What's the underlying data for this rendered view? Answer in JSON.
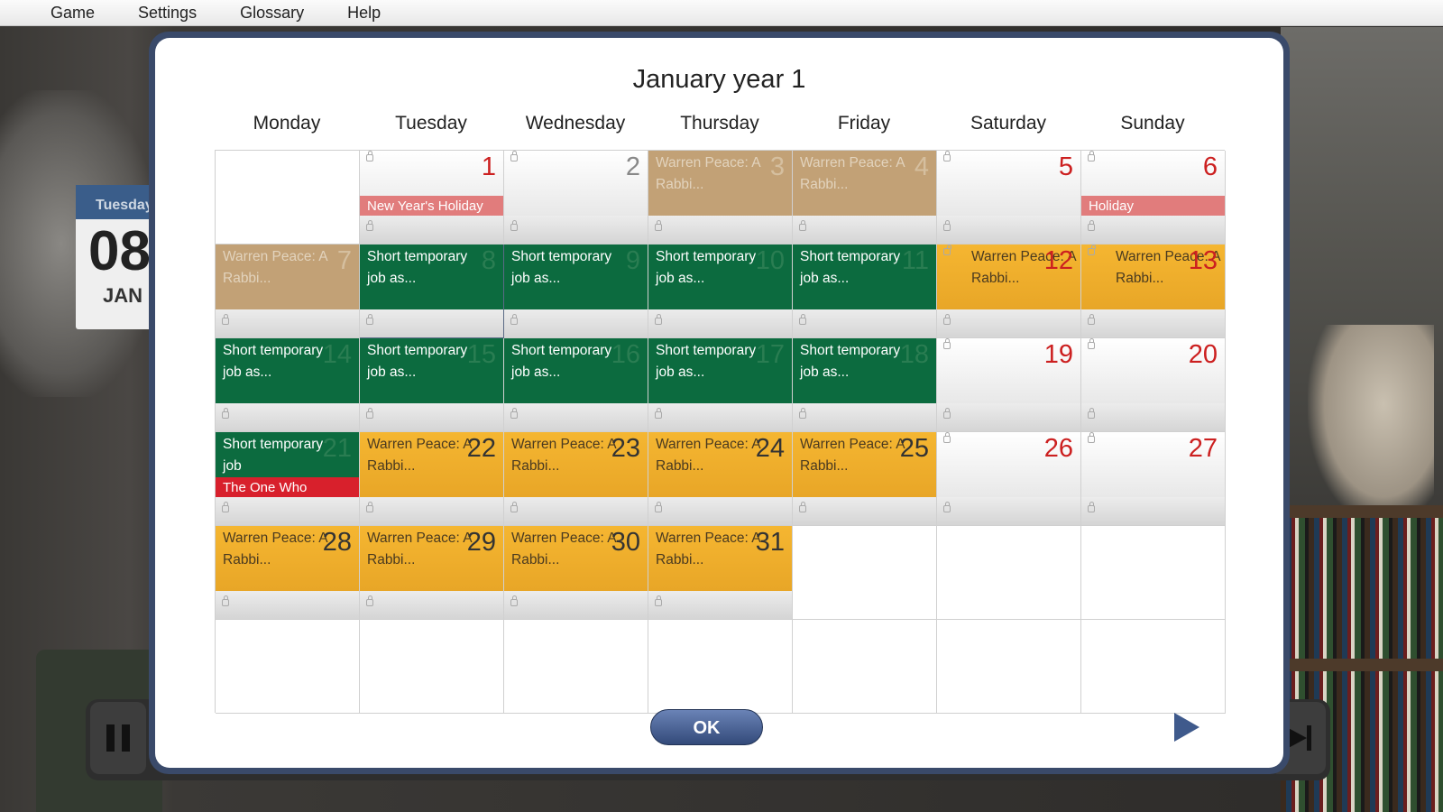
{
  "menu": [
    "Game",
    "Settings",
    "Glossary",
    "Help"
  ],
  "background": {
    "desk_calendar": {
      "weekday": "Tuesday",
      "day": "08",
      "month": "JAN"
    }
  },
  "dialog": {
    "title": "January year 1",
    "weekdays": [
      "Monday",
      "Tuesday",
      "Wednesday",
      "Thursday",
      "Friday",
      "Saturday",
      "Sunday"
    ],
    "ok_label": "OK",
    "cells": [
      {
        "empty": true
      },
      {
        "day": "1",
        "weekendColor": true,
        "label": "New Year's Holiday",
        "labelStyle": "pink"
      },
      {
        "day": "2"
      },
      {
        "day": "3",
        "style": "tan",
        "text": "Warren Peace: A Rabbi..."
      },
      {
        "day": "4",
        "style": "tan",
        "text": "Warren Peace: A Rabbi..."
      },
      {
        "day": "5",
        "weekend": true
      },
      {
        "day": "6",
        "weekend": true,
        "label": "Holiday",
        "labelStyle": "pink"
      },
      {
        "day": "7",
        "style": "tan",
        "text": "Warren Peace: A Rabbi..."
      },
      {
        "day": "8",
        "style": "green",
        "text": "Short temporary job as...",
        "selected": true
      },
      {
        "day": "9",
        "style": "green",
        "text": "Short temporary job as..."
      },
      {
        "day": "10",
        "style": "green",
        "text": "Short temporary job as..."
      },
      {
        "day": "11",
        "style": "green",
        "text": "Short temporary job as..."
      },
      {
        "day": "12",
        "style": "orange",
        "weekend": true,
        "text": "Warren Peace: A Rabbi...",
        "openLock": true
      },
      {
        "day": "13",
        "style": "orange",
        "weekend": true,
        "text": "Warren Peace: A Rabbi...",
        "openLock": true
      },
      {
        "day": "14",
        "style": "green",
        "text": "Short temporary job as..."
      },
      {
        "day": "15",
        "style": "green",
        "text": "Short temporary job as..."
      },
      {
        "day": "16",
        "style": "green",
        "text": "Short temporary job as..."
      },
      {
        "day": "17",
        "style": "green",
        "text": "Short temporary job as..."
      },
      {
        "day": "18",
        "style": "green",
        "text": "Short temporary job as..."
      },
      {
        "day": "19",
        "weekend": true
      },
      {
        "day": "20",
        "weekend": true
      },
      {
        "day": "21",
        "style": "green",
        "text": "Short temporary job",
        "label": "The One Who",
        "labelStyle": "red"
      },
      {
        "day": "22",
        "style": "orange",
        "text": "Warren Peace: A Rabbi..."
      },
      {
        "day": "23",
        "style": "orange",
        "text": "Warren Peace: A Rabbi..."
      },
      {
        "day": "24",
        "style": "orange",
        "text": "Warren Peace: A Rabbi..."
      },
      {
        "day": "25",
        "style": "orange",
        "text": "Warren Peace: A Rabbi..."
      },
      {
        "day": "26",
        "weekend": true
      },
      {
        "day": "27",
        "weekend": true
      },
      {
        "day": "28",
        "style": "orange",
        "text": "Warren Peace: A Rabbi..."
      },
      {
        "day": "29",
        "style": "orange",
        "text": "Warren Peace: A Rabbi..."
      },
      {
        "day": "30",
        "style": "orange",
        "text": "Warren Peace: A Rabbi..."
      },
      {
        "day": "31",
        "style": "orange",
        "text": "Warren Peace: A Rabbi..."
      },
      {
        "empty": true
      },
      {
        "empty": true
      },
      {
        "empty": true
      },
      {
        "empty": true
      },
      {
        "empty": true
      },
      {
        "empty": true
      },
      {
        "empty": true
      },
      {
        "empty": true
      },
      {
        "empty": true
      },
      {
        "empty": true
      }
    ]
  },
  "colors": {
    "job_green": "#0c6b3f",
    "book_orange": "#f5b631",
    "past_tan": "#c2a176",
    "holiday_pink": "#e17c7c",
    "event_red": "#d8202c",
    "weekend_red": "#cc2020",
    "dialog_frame": "#3a4a6a"
  },
  "icons": {
    "pause": "pause-icon",
    "skip": "skip-forward-icon",
    "next": "next-arrow-icon",
    "lock": "lock-icon"
  }
}
